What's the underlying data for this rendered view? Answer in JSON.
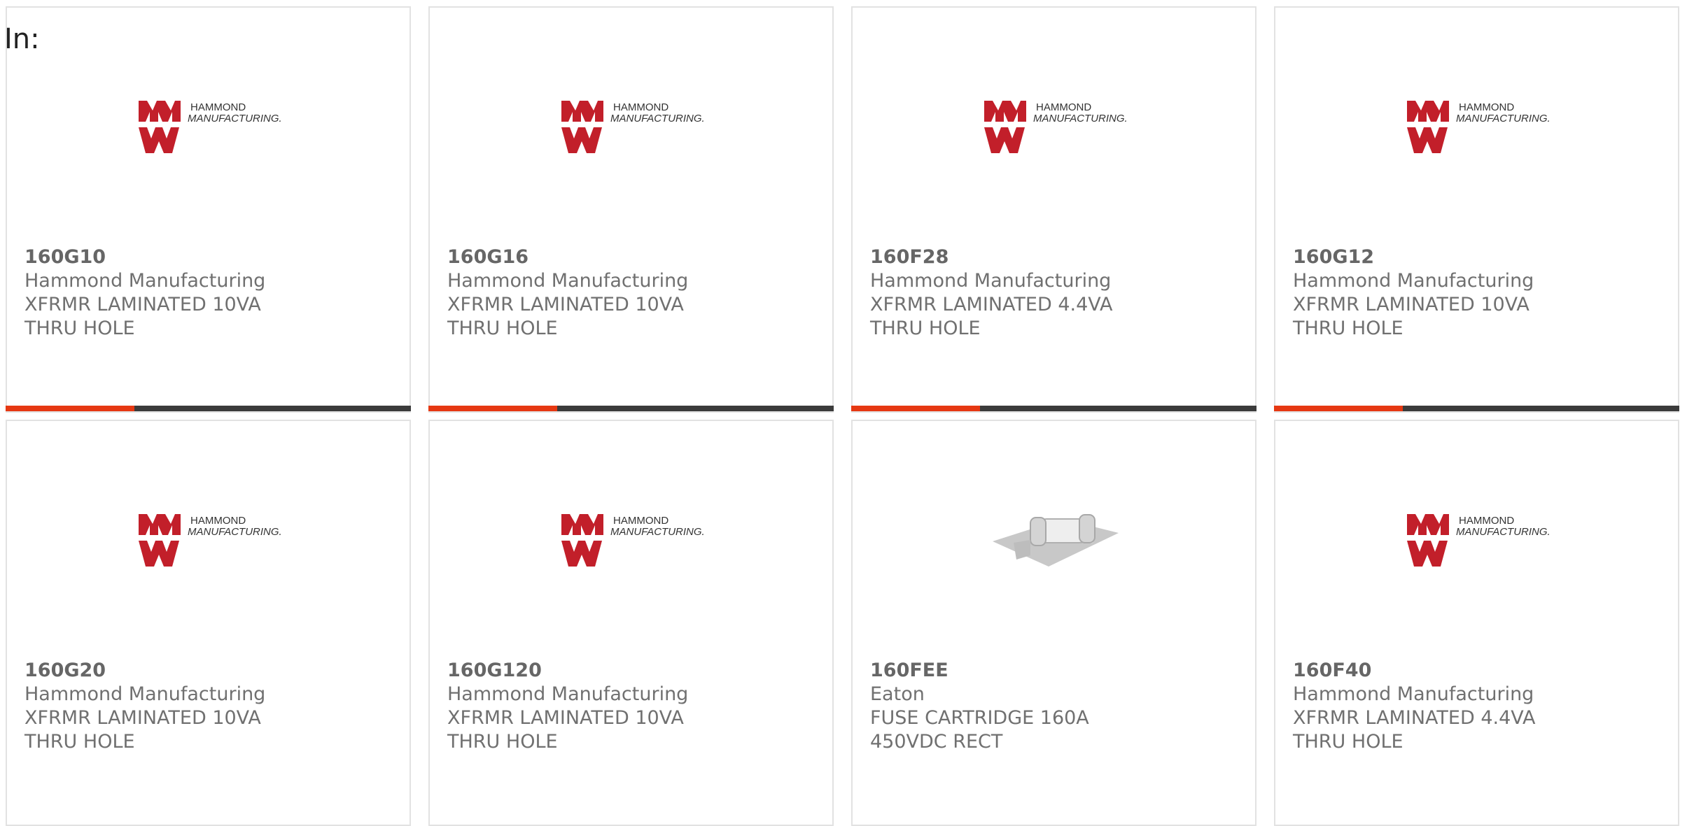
{
  "filter": {
    "label": "In:"
  },
  "colors": {
    "accent": "#e63812",
    "bar": "#3b3b3b",
    "logo_red": "#c21f2a"
  },
  "products": [
    {
      "part_number": "160G10",
      "manufacturer": "Hammond Manufacturing",
      "description": "XFRMR LAMINATED 10VA THRU HOLE",
      "image": "hammond-logo",
      "logo_line1": "HAMMOND",
      "logo_line2": "MANUFACTURING."
    },
    {
      "part_number": "160G16",
      "manufacturer": "Hammond Manufacturing",
      "description": "XFRMR LAMINATED 10VA THRU HOLE",
      "image": "hammond-logo",
      "logo_line1": "HAMMOND",
      "logo_line2": "MANUFACTURING."
    },
    {
      "part_number": "160F28",
      "manufacturer": "Hammond Manufacturing",
      "description": "XFRMR LAMINATED 4.4VA THRU HOLE",
      "image": "hammond-logo",
      "logo_line1": "HAMMOND",
      "logo_line2": "MANUFACTURING."
    },
    {
      "part_number": "160G12",
      "manufacturer": "Hammond Manufacturing",
      "description": "XFRMR LAMINATED 10VA THRU HOLE",
      "image": "hammond-logo",
      "logo_line1": "HAMMOND",
      "logo_line2": "MANUFACTURING."
    },
    {
      "part_number": "160G20",
      "manufacturer": "Hammond Manufacturing",
      "description": "XFRMR LAMINATED 10VA THRU HOLE",
      "image": "hammond-logo",
      "logo_line1": "HAMMOND",
      "logo_line2": "MANUFACTURING."
    },
    {
      "part_number": "160G120",
      "manufacturer": "Hammond Manufacturing",
      "description": "XFRMR LAMINATED 10VA THRU HOLE",
      "image": "hammond-logo",
      "logo_line1": "HAMMOND",
      "logo_line2": "MANUFACTURING."
    },
    {
      "part_number": "160FEE",
      "manufacturer": "Eaton",
      "description": "FUSE CARTRIDGE 160A 450VDC RECT",
      "image": "fuse-cartridge-photo"
    },
    {
      "part_number": "160F40",
      "manufacturer": "Hammond Manufacturing",
      "description": "XFRMR LAMINATED 4.4VA THRU HOLE",
      "image": "hammond-logo",
      "logo_line1": "HAMMOND",
      "logo_line2": "MANUFACTURING."
    }
  ]
}
